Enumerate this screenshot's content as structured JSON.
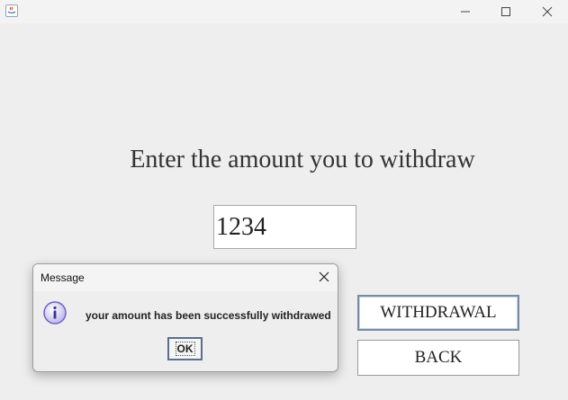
{
  "window": {
    "icon": "java-icon",
    "controls": [
      "minimize-icon",
      "maximize-icon",
      "close-icon"
    ]
  },
  "form": {
    "prompt": "Enter the amount you to withdraw",
    "amount_value": "1234",
    "withdraw_label": "WITHDRAWAL",
    "back_label": "BACK"
  },
  "dialog": {
    "title": "Message",
    "icon": "info-icon",
    "message": "your amount has been successfully withdrawed",
    "ok_label": "OK"
  },
  "colors": {
    "background": "#eeeeee",
    "info_icon": "#6e63c5",
    "focus_border": "#7a8ba3"
  }
}
